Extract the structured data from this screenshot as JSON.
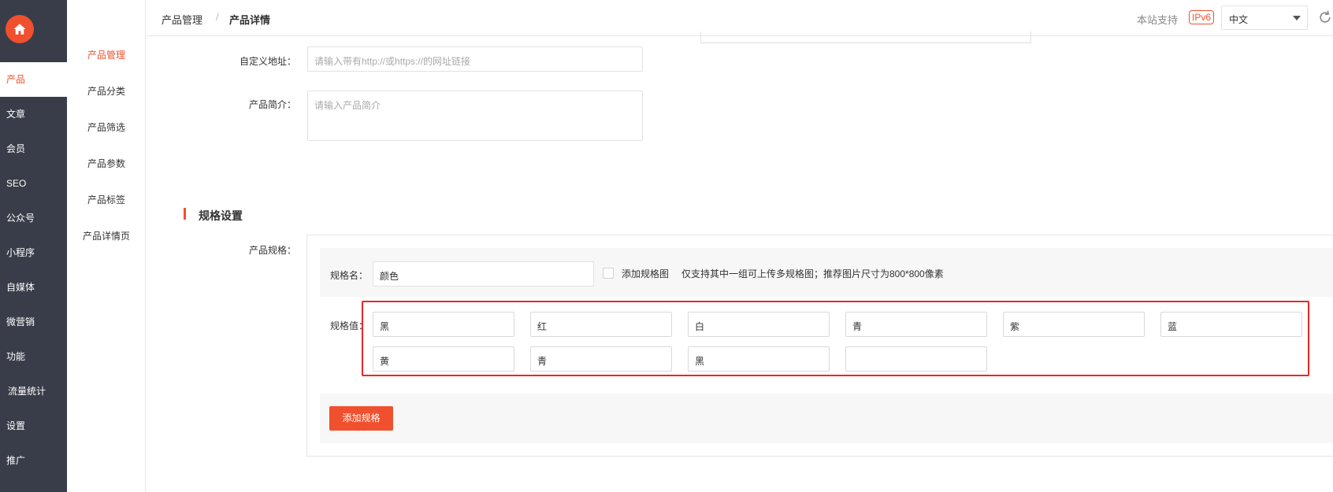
{
  "nav": {
    "items": [
      {
        "label": "产品",
        "active": true
      },
      {
        "label": "文章"
      },
      {
        "label": "会员"
      },
      {
        "label": "SEO"
      },
      {
        "label": "公众号"
      },
      {
        "label": "小程序"
      },
      {
        "label": "自媒体"
      },
      {
        "label": "微营销"
      },
      {
        "label": "功能"
      },
      {
        "label": "流量统计"
      },
      {
        "label": "设置"
      },
      {
        "label": "推广"
      }
    ]
  },
  "submenu": {
    "items": [
      {
        "label": "产品管理",
        "active": true
      },
      {
        "label": "产品分类"
      },
      {
        "label": "产品筛选"
      },
      {
        "label": "产品参数"
      },
      {
        "label": "产品标签"
      },
      {
        "label": "产品详情页"
      }
    ]
  },
  "header": {
    "breadcrumb": [
      "产品管理",
      "产品详情"
    ],
    "separator": "/",
    "support_text": "本站支持",
    "ipv6_badge": "IPv6",
    "language": "中文"
  },
  "form": {
    "custom_url": {
      "label": "自定义地址：",
      "placeholder": "请输入带有http://或https://的网址链接"
    },
    "intro": {
      "label": "产品简介：",
      "placeholder": "请输入产品简介"
    }
  },
  "spec": {
    "section_title": "规格设置",
    "field_label": "产品规格：",
    "name_label": "规格名：",
    "name_value": "颜色",
    "add_image_label": "添加规格图",
    "hint": "仅支持其中一组可上传多规格图；推荐图片尺寸为800*800像素",
    "values_label": "规格值：",
    "values": [
      "黑",
      "红",
      "白",
      "青",
      "紫",
      "蓝",
      "黄",
      "青",
      "黑",
      ""
    ],
    "add_button": "添加规格"
  },
  "colors": {
    "accent": "#f0502d",
    "sidebar": "#393d49",
    "highlight_frame": "#e8262a"
  }
}
